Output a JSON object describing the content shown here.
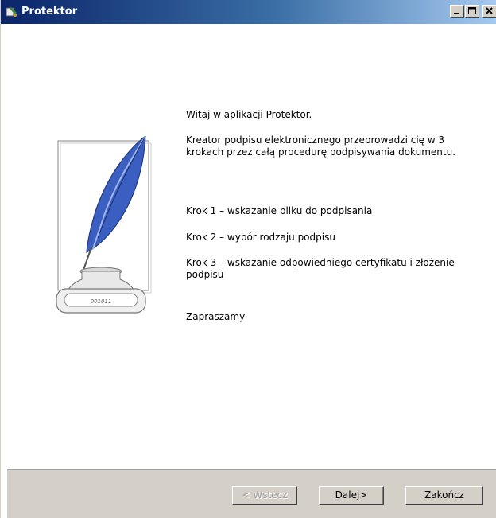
{
  "window": {
    "title": "Protektor",
    "controls": {
      "minimize": "minimize",
      "maximize": "maximize",
      "close": "close"
    }
  },
  "content": {
    "welcome": "Witaj w aplikacji Protektor.",
    "description": "Kreator podpisu elektronicznego przeprowadzi cię w 3 krokach przez całą procedurę podpisywania dokumentu.",
    "step1": "Krok 1 – wskazanie pliku do podpisania",
    "step2": "Krok 2 – wybór rodzaju podpisu",
    "step3": "Krok 3 – wskazanie odpowiedniego certyfikatu i złożenie podpisu",
    "invite": "Zapraszamy",
    "illustration_label": "001011"
  },
  "footer": {
    "back_label": "< Wstecz",
    "next_label": "Dalej>",
    "finish_label": "Zakończ"
  },
  "colors": {
    "titlebar_start": "#0a246a",
    "titlebar_end": "#a6caf0",
    "button_face": "#d4d0c8",
    "feather": "#3b5fc0"
  },
  "icons": [
    "app-icon",
    "minimize-icon",
    "maximize-icon",
    "close-icon",
    "quill-inkwell-illustration"
  ]
}
